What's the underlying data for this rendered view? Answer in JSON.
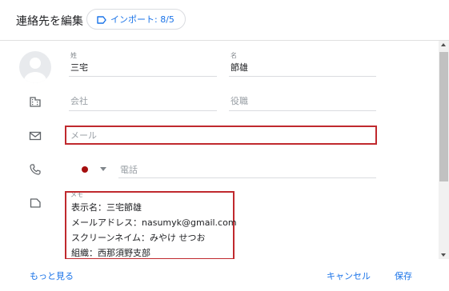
{
  "header": {
    "title": "連絡先を編集",
    "import_chip_label": "インポート: 8/5"
  },
  "form": {
    "last_name": {
      "label": "姓",
      "value": "三宅"
    },
    "first_name": {
      "label": "名",
      "value": "節雄"
    },
    "company": {
      "placeholder": "会社"
    },
    "job_title": {
      "placeholder": "役職"
    },
    "email": {
      "placeholder": "メール"
    },
    "phone": {
      "placeholder": "電話",
      "country_color": "#a50e0e"
    },
    "memo": {
      "label": "メモ",
      "lines": [
        "表示名：三宅節雄",
        "メールアドレス：nasumyk@gmail.com",
        "スクリーンネイム：みやけ せつお",
        "組織：西那須野支部"
      ]
    }
  },
  "footer": {
    "more_label": "もっと見る",
    "cancel_label": "キャンセル",
    "save_label": "保存"
  },
  "colors": {
    "accent": "#1a73e8",
    "highlight_border": "#c0292e"
  }
}
